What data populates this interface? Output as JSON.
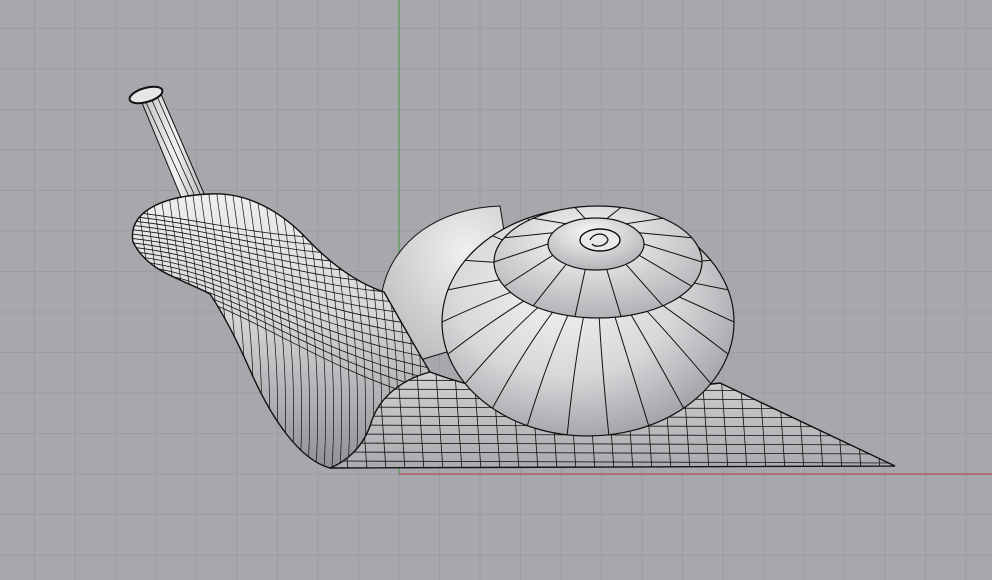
{
  "viewport": {
    "view": "front",
    "background_color": "#a6a8ac",
    "grid": {
      "visible": true,
      "minor_line_color": "#9a9da2",
      "major_line_color": "#8c8f94"
    },
    "axes": {
      "x_axis_color": "#b33a3a",
      "z_axis_color": "#3c9b4d"
    },
    "model": {
      "name": "snail",
      "display_mode": "shaded",
      "surface_color": "#cfd0d2",
      "isocurve_color": "#111111",
      "parts": [
        "head",
        "eye-stalk",
        "body",
        "foot",
        "shell"
      ]
    }
  }
}
